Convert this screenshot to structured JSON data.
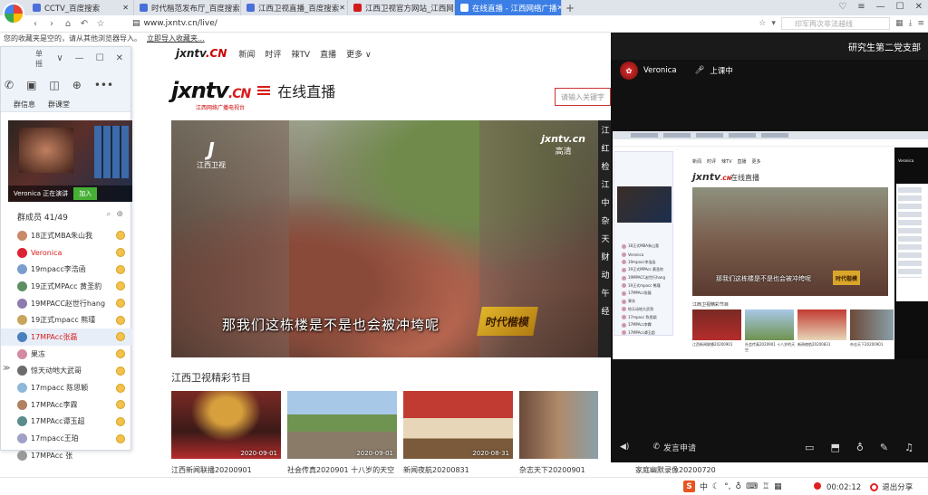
{
  "browser": {
    "tabs": [
      {
        "title": "CCTV_百度搜索",
        "fav": "#4a6fd8"
      },
      {
        "title": "时代楷范发布厅_百度搜索",
        "fav": "#4a6fd8"
      },
      {
        "title": "江西卫视直播_百度搜索",
        "fav": "#4a6fd8"
      },
      {
        "title": "江西卫视官方网站_江西网",
        "fav": "#d21b1b"
      },
      {
        "title": "在线直播 - 江西网络广播",
        "fav": "#d21b1b"
      }
    ],
    "url": "www.jxntv.cn/live/",
    "search_placeholder": "印军再次非法越线",
    "bookmark_notice": "您的收藏夹是空的，请从其他浏览器导入。",
    "bookmark_import": "立即导入收藏夹..."
  },
  "site": {
    "logo": "jxntv",
    "logo_cn": ".CN",
    "nav": [
      "新闻",
      "时评",
      "辣TV",
      "直播",
      "更多"
    ],
    "brand": "jxntv",
    "brand_suffix": ".CN",
    "brand_tagline": "江西网络广播电视台",
    "live_title": "在线直播",
    "search_placeholder": "请输入关键字",
    "player": {
      "caption": "那我们这栋楼是不是也会被冲垮呢",
      "left_logo": "江西卫视",
      "right_logo": "jxntv.cn",
      "right_logo_sub": "高清",
      "badge": "时代楷模"
    },
    "side_list": [
      "江",
      "红",
      "检",
      "江",
      "中",
      "杂",
      "天",
      "财",
      "动",
      "午",
      "经"
    ],
    "programs_title": "江西卫视精彩节目",
    "programs": [
      {
        "date": "2020-09-01",
        "title": "江西新闻联播20200901"
      },
      {
        "date": "2020-09-01",
        "title": "社会传真2020901 十八岁的天空"
      },
      {
        "date": "2020-08-31",
        "title": "新闻夜航20200831"
      },
      {
        "date": "",
        "title": "杂志天下20200901"
      },
      {
        "date": "",
        "title": "家庭幽默录像20200720"
      }
    ]
  },
  "chat": {
    "name": "单摇",
    "tabs": [
      "群信息",
      "群课堂"
    ],
    "preview_text": "Veronica 正在演讲",
    "join_label": "加入",
    "members_title": "群成员 41/49",
    "members": [
      {
        "name": "18正式MBA朱山我",
        "color": "#c98a6a"
      },
      {
        "name": "Veronica",
        "color": "#d23",
        "red": true
      },
      {
        "name": "19mpacc李浩函",
        "color": "#7a9fcf"
      },
      {
        "name": "19正式MPAcc 黄圣豹",
        "color": "#5e8f62"
      },
      {
        "name": "19MPACC赵世行hang",
        "color": "#8d7bb0"
      },
      {
        "name": "19正式mpacc 熊瑾",
        "color": "#c9a45c"
      },
      {
        "name": "17MPAcc张磊",
        "color": "#4a7fc0",
        "red": true,
        "sel": true
      },
      {
        "name": "果冻",
        "color": "#d38aa0"
      },
      {
        "name": "惊天动地大武哥",
        "color": "#6c6c6c"
      },
      {
        "name": "17mpacc 陈思颖",
        "color": "#8fb8d8"
      },
      {
        "name": "17MPAcc李霖",
        "color": "#b08060"
      },
      {
        "name": "17MPAcc谭玉超",
        "color": "#5a8c8c"
      },
      {
        "name": "17mpacc王珀",
        "color": "#a0a0c8"
      },
      {
        "name": "17MPAcc 张",
        "color": "#999"
      }
    ]
  },
  "share": {
    "group_title": "研究生第二党支部",
    "user": "Veronica",
    "status": "上课中",
    "mini": {
      "site_nav": [
        "新闻",
        "时评",
        "辣TV",
        "直播",
        "更多"
      ],
      "live_title": "在线直播",
      "caption": "那我们这栋楼是不是也会被冲垮呢",
      "programs_title": "江西卫视精彩节目",
      "captions": [
        "江西新闻联播20200901",
        "社会传真2020901 十八岁的天空",
        "新闻夜航20200831",
        "杂志天下20200901",
        "家庭幽默录像20200720"
      ],
      "user": "Veronica"
    },
    "speak_label": "发言申请"
  },
  "taskbar": {
    "ime": "中",
    "timer": "00:02:12",
    "exit_label": "退出分享"
  }
}
